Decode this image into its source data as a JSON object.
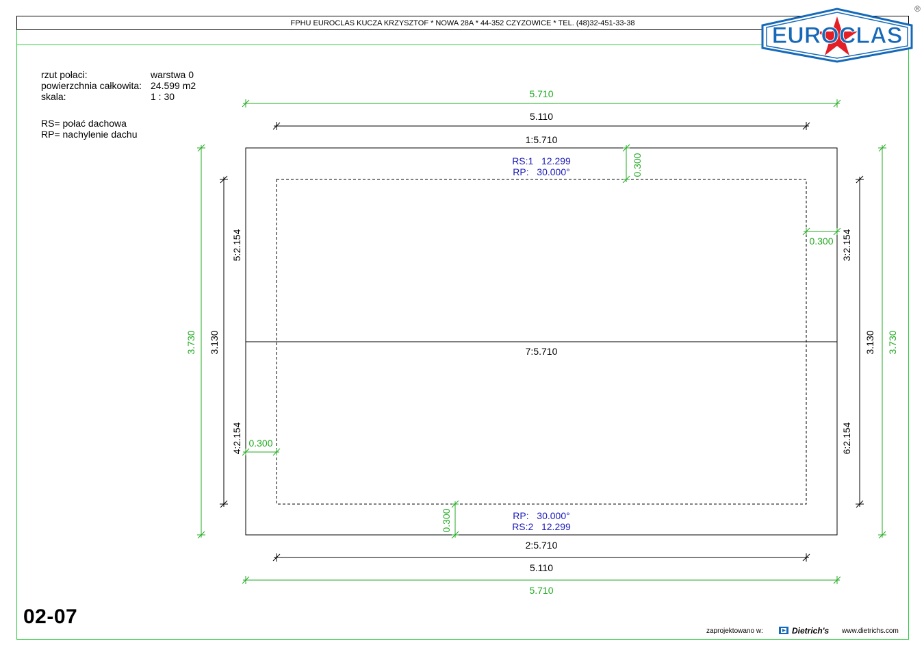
{
  "header": {
    "company_line": "FPHU EUROCLAS KUCZA KRZYSZTOF * NOWA 28A * 44-352 CZYZOWICE * TEL. (48)32-451-33-38"
  },
  "logo": {
    "text": "EUROCLAS",
    "registered": "®",
    "colors": {
      "blue": "#1569b8",
      "red": "#e31e24"
    },
    "icon": "star-logo-icon"
  },
  "info": {
    "label_rzut": "rzut połaci:",
    "value_rzut": "warstwa 0",
    "label_area": "powierzchnia całkowita:",
    "value_area": "24.599 m2",
    "label_scale": "skala:",
    "value_scale": "1 : 30",
    "legend_rs": "RS= połać dachowa",
    "legend_rp": "RP= nachylenie dachu"
  },
  "drawing": {
    "top_overall": "5.710",
    "top_inner": "5.110",
    "edge_top": "1:5.710",
    "edge_bottom": "2:5.710",
    "edge_middle": "7:5.710",
    "edge_left_upper": "5:2.154",
    "edge_left_lower": "4:2.154",
    "edge_right_upper": "3:2.154",
    "edge_right_lower": "6:2.154",
    "left_overall": "3.730",
    "left_inner": "3.130",
    "right_inner": "3.130",
    "right_overall": "3.730",
    "bottom_inner": "5.110",
    "bottom_overall": "5.710",
    "offset_top": "0.300",
    "offset_right": "0.300",
    "offset_left": "0.300",
    "offset_bottom": "0.300",
    "rs1": "RS:1   12.299",
    "rp1": "RP:   30.000°",
    "rp2": "RP:   30.000°",
    "rs2": "RS:2   12.299",
    "colors": {
      "dimension": "#22aa22",
      "label": "#1a1ab8",
      "line": "#000000"
    }
  },
  "sheet": {
    "number": "02-07"
  },
  "footer": {
    "designed_with": "zaprojektowano w:",
    "brand": "Dietrich's",
    "url": "www.dietrichs.com",
    "icon": "dietrichs-logo-icon"
  }
}
